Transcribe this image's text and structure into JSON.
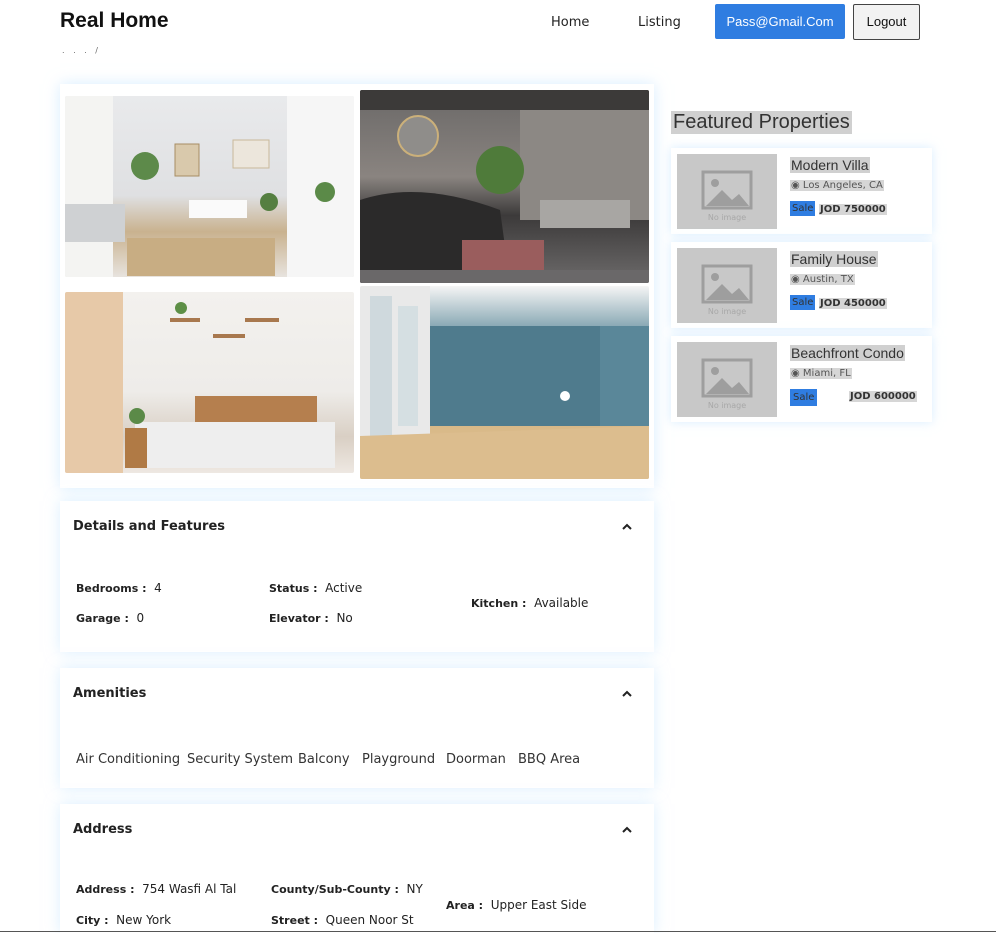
{
  "nav": {
    "brand": "Real Home",
    "links": [
      "Home",
      "Listing"
    ],
    "user_button": "Pass@Gmail.Com",
    "logout_button": "Logout",
    "breadcrumb": ". . . /"
  },
  "details": {
    "title": "Details and Features",
    "bedrooms_label": "Bedrooms :",
    "bedrooms": "4",
    "garage_label": "Garage :",
    "garage": "0",
    "status_label": "Status :",
    "status": "Active",
    "elevator_label": "Elevator :",
    "elevator": "No",
    "kitchen_label": "Kitchen :",
    "kitchen": "Available"
  },
  "amenities": {
    "title": "Amenities",
    "items": [
      "Air Conditioning",
      "Security System",
      "Balcony",
      "Playground",
      "Doorman",
      "BBQ Area"
    ]
  },
  "address": {
    "title": "Address",
    "address_label": "Address :",
    "address": "754 Wasfi Al Tal",
    "city_label": "City :",
    "city": "New York",
    "county_label": "County/Sub-County :",
    "county": "NY",
    "street_label": "Street :",
    "street": "Queen Noor St",
    "area_label": "Area :",
    "area": "Upper East Side"
  },
  "featured": {
    "title": "Featured Properties",
    "no_image": "No image",
    "properties": [
      {
        "name": "Modern Villa",
        "location": "Los Angeles, CA",
        "tag": "Sale",
        "price": "JOD 750000"
      },
      {
        "name": "Family House",
        "location": "Austin, TX",
        "tag": "Sale",
        "price": "JOD 450000"
      },
      {
        "name": "Beachfront Condo",
        "location": "Miami, FL",
        "tag": "Sale",
        "price": "JOD 600000"
      }
    ]
  },
  "colors": {
    "accent": "#2f7de1",
    "highlight": "#d0d0d0"
  }
}
